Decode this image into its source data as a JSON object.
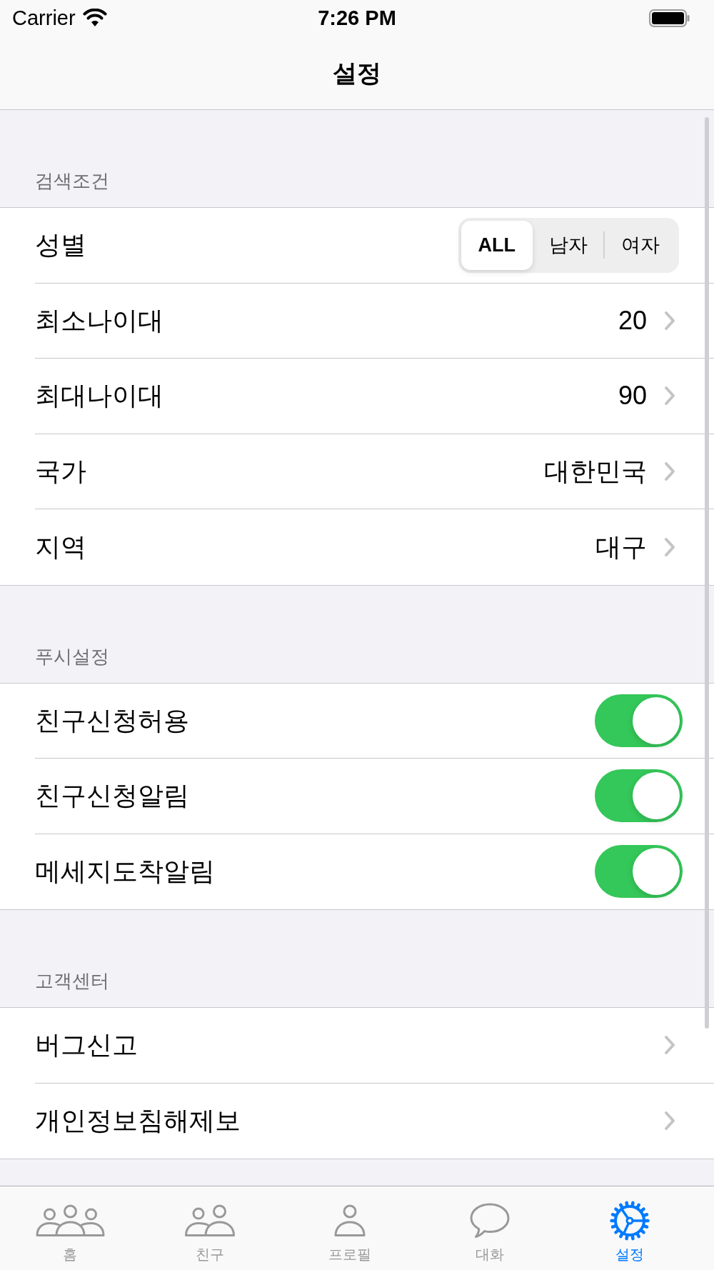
{
  "status_bar": {
    "carrier": "Carrier",
    "time": "7:26 PM"
  },
  "nav_bar": {
    "title": "설정"
  },
  "sections": [
    {
      "header": "검색조건",
      "rows": [
        {
          "kind": "segmented",
          "label": "성별",
          "segments": [
            {
              "label": "ALL",
              "selected": true
            },
            {
              "label": "남자",
              "selected": false
            },
            {
              "label": "여자",
              "selected": false
            }
          ]
        },
        {
          "kind": "disclosure",
          "label": "최소나이대",
          "value": "20"
        },
        {
          "kind": "disclosure",
          "label": "최대나이대",
          "value": "90"
        },
        {
          "kind": "disclosure",
          "label": "국가",
          "value": "대한민국"
        },
        {
          "kind": "disclosure",
          "label": "지역",
          "value": "대구"
        }
      ]
    },
    {
      "header": "푸시설정",
      "rows": [
        {
          "kind": "toggle",
          "label": "친구신청허용",
          "on": true
        },
        {
          "kind": "toggle",
          "label": "친구신청알림",
          "on": true
        },
        {
          "kind": "toggle",
          "label": "메세지도착알림",
          "on": true
        }
      ]
    },
    {
      "header": "고객센터",
      "rows": [
        {
          "kind": "disclosure",
          "label": "버그신고"
        },
        {
          "kind": "disclosure",
          "label": "개인정보침해제보"
        }
      ]
    }
  ],
  "tab_bar": {
    "items": [
      {
        "label": "홈",
        "selected": false
      },
      {
        "label": "친구",
        "selected": false
      },
      {
        "label": "프로필",
        "selected": false
      },
      {
        "label": "대화",
        "selected": false
      },
      {
        "label": "설정",
        "selected": true
      }
    ]
  }
}
